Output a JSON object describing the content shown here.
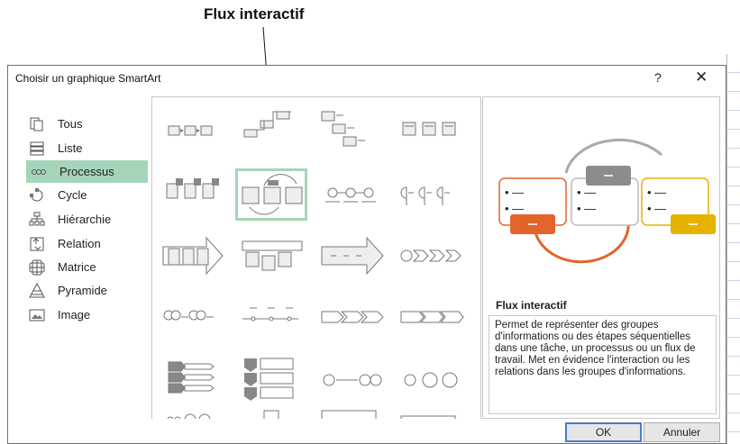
{
  "callout": "Flux interactif",
  "dialog": {
    "title": "Choisir un graphique SmartArt",
    "help": "?",
    "close": "✕"
  },
  "categories": [
    {
      "label": "Tous",
      "icon": "all-icon"
    },
    {
      "label": "Liste",
      "icon": "list-icon"
    },
    {
      "label": "Processus",
      "icon": "process-icon",
      "selected": true
    },
    {
      "label": "Cycle",
      "icon": "cycle-icon"
    },
    {
      "label": "Hiérarchie",
      "icon": "hierarchy-icon"
    },
    {
      "label": "Relation",
      "icon": "relation-icon"
    },
    {
      "label": "Matrice",
      "icon": "matrix-icon"
    },
    {
      "label": "Pyramide",
      "icon": "pyramid-icon"
    },
    {
      "label": "Image",
      "icon": "image-icon"
    }
  ],
  "preview": {
    "title": "Flux interactif",
    "description": "Permet de représenter des groupes d'informations ou des étapes séquentielles dans une tâche, un processus ou un flux de travail. Met en évidence l'interaction ou les relations dans les groupes d'informations."
  },
  "buttons": {
    "ok": "OK",
    "cancel": "Annuler"
  },
  "colors": {
    "selection": "#a4d5b8",
    "orange": "#e3642b",
    "gray": "#8c8c8c",
    "gold": "#e4b200"
  }
}
